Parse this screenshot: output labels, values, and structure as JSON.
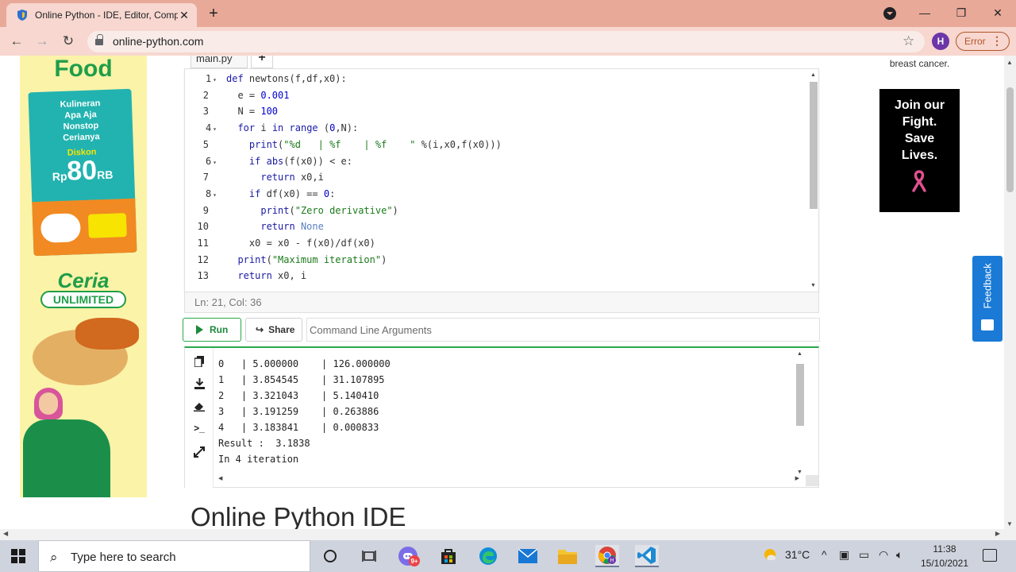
{
  "browser": {
    "tab_title": "Online Python - IDE, Editor, Comp",
    "tab_close": "✕",
    "new_tab": "+",
    "url": "online-python.com",
    "profile_initial": "H",
    "error_label": "Error",
    "minimize": "—",
    "restore": "❐",
    "close": "✕"
  },
  "ads": {
    "left": {
      "title": "Food",
      "promo_lines": [
        "Kulineran",
        "Apa Aja",
        "Nonstop",
        "Cerianya"
      ],
      "discount_label": "Diskon",
      "discount_amount": "80",
      "currency_prefix": "Rp",
      "currency_suffix": "RB",
      "brand_word_1": "Ceria",
      "brand_word_2": "UNLIMITED"
    },
    "right": {
      "top_text": "breast cancer.",
      "headline_lines": [
        "Join our",
        "Fight.",
        "Save",
        "Lives."
      ]
    }
  },
  "editor": {
    "file_tab": "main.py",
    "add_tab": "+",
    "line_numbers": [
      "1",
      "2",
      "3",
      "4",
      "5",
      "6",
      "7",
      "8",
      "9",
      "10",
      "11",
      "12",
      "13"
    ],
    "foldable_lines": [
      "1",
      "4",
      "6",
      "8"
    ],
    "code_lines": [
      "def newtons(f,df,x0):",
      "  e = 0.001",
      "  N = 100",
      "  for i in range (0,N):",
      "    print(\"%d   | %f    | %f    \" %(i,x0,f(x0)))",
      "    if abs(f(x0)) < e:",
      "      return x0,i",
      "    if df(x0) == 0:",
      "      print(\"Zero derivative\")",
      "      return None",
      "    x0 = x0 - f(x0)/df(x0)",
      "  print(\"Maximum iteration\")",
      "  return x0, i"
    ],
    "cursor_status": "Ln: 21,  Col: 36"
  },
  "actions": {
    "run_label": "Run",
    "share_label": "Share",
    "args_placeholder": "Command Line Arguments"
  },
  "console": {
    "output_lines": [
      "0   | 5.000000    | 126.000000",
      "1   | 3.854545    | 31.107895",
      "2   | 3.321043    | 5.140410",
      "3   | 3.191259    | 0.263886",
      "4   | 3.183841    | 0.000833",
      "Result :  3.1838",
      "In 4 iteration"
    ]
  },
  "page": {
    "heading": "Online Python IDE",
    "feedback_label": "Feedback"
  },
  "taskbar": {
    "search_placeholder": "Type here to search",
    "temperature": "31°C",
    "time": "11:38",
    "date": "15/10/2021",
    "discord_badge": "9+"
  },
  "colors": {
    "run_green": "#1d8a3b",
    "titlebar": "#e9a999",
    "feedback_blue": "#1a7ad6"
  }
}
